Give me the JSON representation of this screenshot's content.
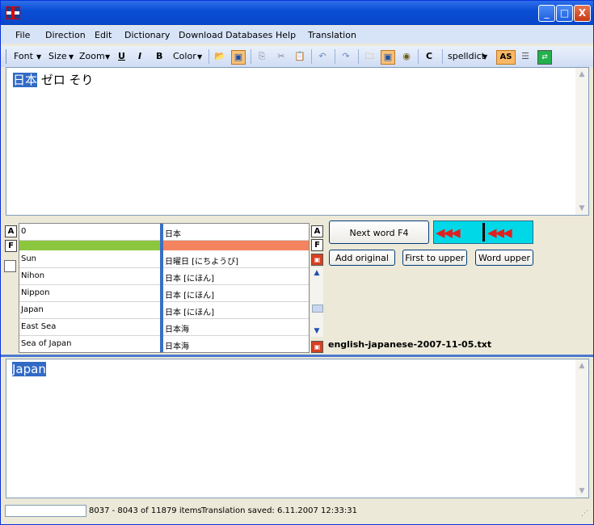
{
  "titlebar": {
    "minimize": "_",
    "maximize": "□",
    "close": "X"
  },
  "menu": [
    "File",
    "Direction",
    "Edit",
    "Dictionary",
    "Download Databases",
    "Help",
    "Translation"
  ],
  "toolbar": {
    "font": "Font",
    "size": "Size",
    "zoom": "Zoom",
    "underline": "U",
    "italic": "I",
    "bold": "B",
    "color": "Color",
    "c_label": "C",
    "spelldict": "spelldict",
    "as_label": "AS"
  },
  "source_text": {
    "highlight": "日本",
    "rest": " ゼロ そり"
  },
  "grid": {
    "header_left": "0",
    "header_right": "日本",
    "rows": [
      {
        "left": "Sun",
        "right": "日曜日 [にちようび]"
      },
      {
        "left": "Nihon",
        "right": "日本 [にほん]"
      },
      {
        "left": "Nippon",
        "right": "日本 [にほん]"
      },
      {
        "left": "Japan",
        "right": "日本 [にほん]"
      },
      {
        "left": "East Sea",
        "right": "日本海"
      },
      {
        "left": "Sea of Japan",
        "right": "日本海"
      }
    ],
    "a_label": "A",
    "f_label": "F"
  },
  "buttons": {
    "next_word": "Next word   F4",
    "add_original": "Add original",
    "first_upper": "First to upper",
    "word_upper": "Word upper"
  },
  "dict_file": "english-japanese-2007-11-05.txt",
  "target_text": "Japan",
  "status": {
    "items": "8037 - 8043 of 11879 items",
    "saved": "Translation saved:  6.11.2007 12:33:31"
  },
  "colors": {
    "green_bar": "#8cc63f",
    "orange_bar": "#f4845f",
    "cyan": "#00d8e8",
    "selection": "#316ac5"
  }
}
